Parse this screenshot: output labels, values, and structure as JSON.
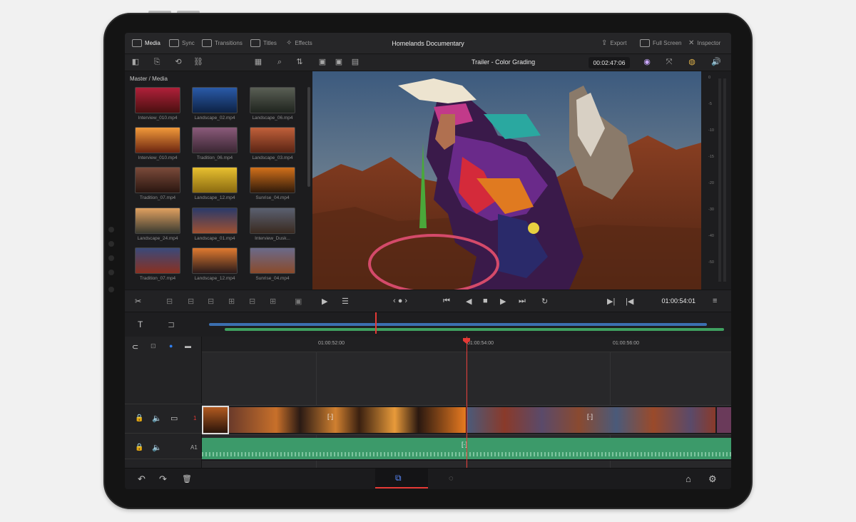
{
  "app": {
    "project_title": "Homelands Documentary"
  },
  "menu": {
    "left": [
      {
        "label": "Media",
        "icon": "media-icon",
        "active": true
      },
      {
        "label": "Sync",
        "icon": "sync-icon",
        "active": false
      },
      {
        "label": "Transitions",
        "icon": "transitions-icon",
        "active": false
      },
      {
        "label": "Titles",
        "icon": "titles-icon",
        "active": false
      },
      {
        "label": "Effects",
        "icon": "effects-icon",
        "active": false
      }
    ],
    "right": [
      {
        "label": "Export",
        "icon": "export-icon"
      },
      {
        "label": "Full Screen",
        "icon": "fullscreen-icon"
      },
      {
        "label": "Inspector",
        "icon": "inspector-icon"
      }
    ]
  },
  "viewer": {
    "timeline_name": "Trailer - Color Grading",
    "duration": "00:02:47:06",
    "current_timecode": "01:00:54:01"
  },
  "media_pool": {
    "breadcrumb": "Master / Media",
    "clips": [
      {
        "name": "Interview_010.mp4",
        "colors": [
          "#b0203a",
          "#4a1010"
        ]
      },
      {
        "name": "Landscape_02.mp4",
        "colors": [
          "#2a5aa8",
          "#0d2244"
        ]
      },
      {
        "name": "Landscape_06.mp4",
        "colors": [
          "#5a5f55",
          "#1f241e"
        ]
      },
      {
        "name": "Interview_010.mp4",
        "colors": [
          "#f29a3a",
          "#6b2410"
        ]
      },
      {
        "name": "Tradition_06.mp4",
        "colors": [
          "#8a5a7a",
          "#3a2632"
        ]
      },
      {
        "name": "Landscape_03.mp4",
        "colors": [
          "#c0603a",
          "#5a2414"
        ]
      },
      {
        "name": "Tradition_07.mp4",
        "colors": [
          "#7a4a3a",
          "#2a1610"
        ]
      },
      {
        "name": "Landscape_12.mp4",
        "colors": [
          "#e8c030",
          "#8a6a10"
        ]
      },
      {
        "name": "Sunrise_04.mp4",
        "colors": [
          "#d2701a",
          "#301a0a"
        ]
      },
      {
        "name": "Landscape_24.mp4",
        "colors": [
          "#e0a060",
          "#3a3a30"
        ]
      },
      {
        "name": "Landscape_01.mp4",
        "colors": [
          "#2a3a6a",
          "#a05030"
        ]
      },
      {
        "name": "Interview_Dusk...",
        "colors": [
          "#5a6070",
          "#3a2a20"
        ]
      },
      {
        "name": "Tradition_07.mp4",
        "colors": [
          "#3a4a7a",
          "#8a3020"
        ]
      },
      {
        "name": "Landscape_12.mp4",
        "colors": [
          "#e07a30",
          "#2a1a1a"
        ]
      },
      {
        "name": "Sunrise_04.mp4",
        "colors": [
          "#6a6a8a",
          "#8a4a2a"
        ]
      }
    ]
  },
  "meter_ticks": [
    "0",
    "-5",
    "-10",
    "-15",
    "-20",
    "-30",
    "-40",
    "-50"
  ],
  "timeline": {
    "ruler": [
      "01:00:52:00",
      "01:00:54:00",
      "01:00:56:00"
    ],
    "video_track_label": "1",
    "audio_track_label": "A1"
  },
  "colors": {
    "accent": "#e53935",
    "audio": "#3c9a6a",
    "mini_video": "#3b6fb0",
    "mini_audio": "#3fa060"
  }
}
